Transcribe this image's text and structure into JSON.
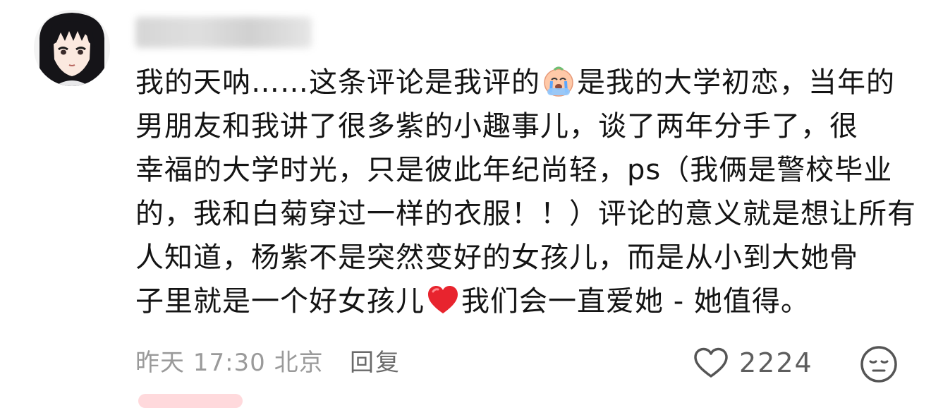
{
  "comment": {
    "username": "",
    "lines": [
      {
        "before": "我的天呐……这条评论是我评的",
        "emoji": "crying-face-emoji",
        "after": "是我的大学初恋，当年的"
      },
      {
        "text": "男朋友和我讲了很多紫的小趣事儿，谈了两年分手了，很"
      },
      {
        "text": "幸福的大学时光，只是彼此年纪尚轻，ps（我俩是警校毕业"
      },
      {
        "text": "的，我和白菊穿过一样的衣服！！）评论的意义就是想让所有"
      },
      {
        "text": "人知道，杨紫不是突然变好的女孩儿，而是从小到大她骨"
      },
      {
        "before": "子里就是一个好女孩儿",
        "emoji": "red-heart-emoji",
        "after": "我们会一直爱她 - 她值得。"
      }
    ]
  },
  "footer": {
    "timestamp": "昨天 17:30 北京",
    "reply_label": "回复",
    "like_count": "2224",
    "like_icon": "heart-outline-icon",
    "reaction_icon": "neutral-face-icon"
  },
  "colors": {
    "text": "#141414",
    "meta": "#9a9a9a",
    "reply": "#6a6a6a",
    "icon": "#555555",
    "heart": "#e8242e"
  }
}
